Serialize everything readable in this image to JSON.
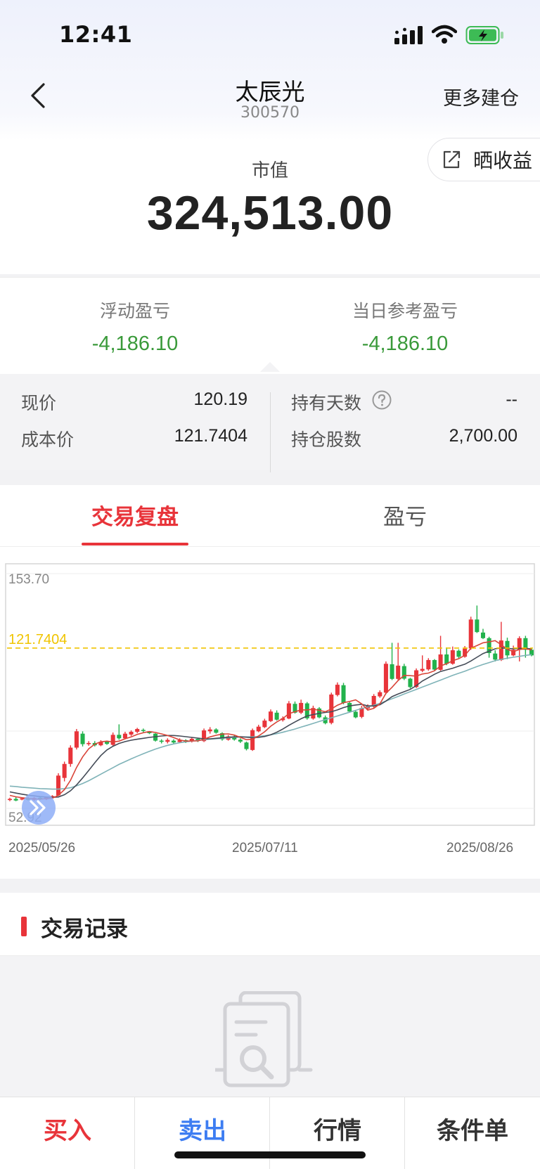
{
  "status_bar": {
    "time": "12:41"
  },
  "nav": {
    "title": "太辰光",
    "code": "300570",
    "more_label": "更多建仓"
  },
  "share": {
    "label": "晒收益"
  },
  "market_value": {
    "label": "市值",
    "value": "324,513.00"
  },
  "pl": {
    "floating_label": "浮动盈亏",
    "floating_value": "-4,186.10",
    "daily_label": "当日参考盈亏",
    "daily_value": "-4,186.10"
  },
  "details": {
    "price_label": "现价",
    "price_value": "120.19",
    "cost_label": "成本价",
    "cost_value": "121.7404",
    "days_label": "持有天数",
    "days_value": "--",
    "shares_label": "持仓股数",
    "shares_value": "2,700.00"
  },
  "tabs": {
    "review": "交易复盘",
    "pnl": "盈亏"
  },
  "chart_data": {
    "type": "candlestick",
    "y_max_label": "153.70",
    "y_min_label": "52.92",
    "ylim": [
      52.92,
      153.7
    ],
    "cost_line": 121.7404,
    "cost_label": "121.7404",
    "x_labels": [
      "2025/05/26",
      "2025/07/11",
      "2025/08/26"
    ],
    "up_color": "#e8343a",
    "down_color": "#22b24c",
    "candles": [
      [
        56.5,
        57.0,
        56.0,
        57.5
      ],
      [
        57.0,
        56.3,
        56.0,
        57.8
      ],
      [
        56.8,
        57.2,
        56.4,
        57.6
      ],
      [
        57.3,
        56.6,
        56.3,
        57.9
      ],
      [
        56.6,
        57.4,
        56.2,
        57.8
      ],
      [
        57.5,
        56.8,
        56.5,
        58.0
      ],
      [
        56.8,
        57.6,
        56.5,
        58.0
      ],
      [
        57.6,
        58.2,
        57.3,
        58.6
      ],
      [
        58.5,
        67.0,
        58.2,
        68.0
      ],
      [
        66.0,
        72.0,
        64.5,
        73.0
      ],
      [
        72.0,
        79.0,
        70.8,
        80.0
      ],
      [
        79.0,
        86.0,
        78.2,
        87.0
      ],
      [
        85.0,
        80.5,
        79.5,
        86.0
      ],
      [
        80.5,
        81.0,
        79.8,
        81.8
      ],
      [
        81.0,
        80.0,
        79.5,
        81.8
      ],
      [
        80.0,
        81.5,
        79.6,
        82.2
      ],
      [
        81.5,
        80.6,
        80.2,
        82.0
      ],
      [
        80.2,
        84.5,
        79.8,
        85.5
      ],
      [
        84.5,
        83.0,
        82.4,
        89.0
      ],
      [
        83.0,
        85.0,
        82.6,
        85.8
      ],
      [
        84.6,
        85.8,
        84.0,
        86.4
      ],
      [
        85.8,
        87.0,
        85.2,
        87.5
      ],
      [
        86.6,
        86.2,
        85.6,
        87.2
      ],
      [
        86.0,
        85.2,
        84.8,
        86.0
      ],
      [
        85.0,
        82.0,
        81.6,
        85.2
      ],
      [
        82.0,
        81.5,
        80.8,
        82.6
      ],
      [
        81.5,
        82.3,
        80.8,
        83.0
      ],
      [
        82.0,
        81.2,
        80.6,
        82.6
      ],
      [
        81.4,
        82.2,
        81.0,
        83.0
      ],
      [
        82.2,
        81.6,
        81.0,
        82.6
      ],
      [
        81.6,
        82.8,
        81.2,
        83.3
      ],
      [
        82.8,
        82.0,
        81.4,
        83.2
      ],
      [
        81.8,
        86.4,
        81.4,
        87.2
      ],
      [
        86.0,
        86.8,
        85.0,
        87.8
      ],
      [
        86.8,
        85.4,
        85.0,
        87.3
      ],
      [
        85.2,
        82.6,
        82.0,
        85.6
      ],
      [
        82.4,
        83.8,
        82.0,
        84.4
      ],
      [
        83.8,
        82.5,
        82.0,
        84.2
      ],
      [
        82.4,
        81.6,
        81.0,
        83.0
      ],
      [
        81.2,
        78.4,
        77.8,
        81.6
      ],
      [
        78.0,
        86.5,
        77.6,
        87.2
      ],
      [
        86.0,
        88.0,
        85.6,
        88.8
      ],
      [
        87.8,
        90.6,
        87.4,
        91.4
      ],
      [
        90.4,
        94.5,
        90.0,
        95.4
      ],
      [
        94.0,
        91.0,
        90.6,
        95.0
      ],
      [
        90.8,
        91.6,
        90.2,
        92.4
      ],
      [
        91.5,
        98.0,
        91.2,
        99.0
      ],
      [
        97.8,
        94.0,
        93.6,
        98.8
      ],
      [
        94.0,
        98.2,
        93.4,
        99.6
      ],
      [
        98.0,
        91.6,
        91.0,
        98.6
      ],
      [
        91.5,
        96.0,
        91.0,
        97.0
      ],
      [
        95.8,
        92.0,
        91.6,
        96.4
      ],
      [
        92.0,
        89.5,
        89.0,
        92.8
      ],
      [
        89.6,
        101.8,
        89.0,
        102.6
      ],
      [
        101.6,
        106.0,
        101.0,
        107.0
      ],
      [
        105.8,
        98.2,
        97.6,
        106.8
      ],
      [
        98.2,
        94.5,
        94.0,
        98.6
      ],
      [
        94.4,
        92.0,
        91.6,
        95.0
      ],
      [
        92.2,
        96.0,
        91.6,
        97.0
      ],
      [
        95.8,
        96.8,
        95.0,
        97.6
      ],
      [
        96.6,
        101.2,
        96.0,
        102.0
      ],
      [
        101.0,
        102.8,
        100.4,
        103.6
      ],
      [
        102.6,
        115.0,
        102.0,
        116.0
      ],
      [
        114.8,
        108.5,
        108.0,
        124.0
      ],
      [
        108.5,
        114.2,
        108.0,
        124.0
      ],
      [
        114.0,
        108.6,
        108.0,
        115.0
      ],
      [
        108.6,
        105.0,
        104.4,
        109.0
      ],
      [
        105.0,
        112.2,
        104.6,
        113.0
      ],
      [
        112.0,
        112.8,
        111.4,
        118.6
      ],
      [
        112.6,
        116.6,
        112.0,
        117.4
      ],
      [
        116.6,
        112.5,
        112.0,
        117.0
      ],
      [
        112.4,
        119.0,
        112.0,
        127.0
      ],
      [
        119.0,
        115.0,
        114.4,
        122.0
      ],
      [
        115.0,
        120.8,
        114.6,
        122.4
      ],
      [
        120.6,
        118.0,
        117.4,
        121.2
      ],
      [
        118.0,
        121.5,
        117.6,
        122.6
      ],
      [
        121.6,
        134.0,
        121.0,
        135.2
      ],
      [
        134.0,
        128.6,
        128.2,
        140.0
      ],
      [
        128.4,
        126.0,
        125.6,
        130.0
      ],
      [
        126.0,
        119.6,
        117.6,
        126.6
      ],
      [
        119.4,
        116.8,
        116.0,
        120.8
      ],
      [
        116.6,
        125.0,
        116.2,
        133.0
      ],
      [
        124.8,
        118.6,
        117.0,
        126.2
      ],
      [
        118.6,
        121.0,
        118.2,
        122.8
      ],
      [
        121.0,
        126.0,
        116.0,
        126.8
      ],
      [
        126.0,
        121.0,
        117.6,
        127.0
      ],
      [
        121.0,
        118.6,
        118.2,
        121.6
      ]
    ],
    "ma5": [
      58.5,
      57.9,
      57.5,
      57.2,
      57.0,
      56.9,
      57.1,
      57.3,
      58.5,
      61.0,
      65.0,
      70.5,
      75.0,
      78.5,
      80.5,
      81.5,
      81.8,
      81.4,
      81.8,
      82.8,
      83.6,
      84.7,
      85.4,
      85.9,
      85.5,
      84.9,
      84.2,
      83.3,
      82.3,
      81.8,
      81.9,
      81.9,
      82.6,
      83.6,
      84.3,
      84.8,
      84.9,
      84.4,
      83.4,
      82.4,
      82.6,
      84.0,
      85.8,
      88.2,
      90.0,
      91.5,
      93.6,
      94.4,
      95.2,
      95.2,
      95.5,
      95.0,
      94.4,
      95.6,
      97.2,
      98.3,
      98.8,
      99.5,
      97.8,
      95.1,
      95.9,
      97.8,
      102.3,
      104.9,
      107.8,
      110.0,
      109.9,
      109.7,
      110.6,
      111.0,
      112.0,
      114.1,
      115.0,
      116.3,
      117.2,
      118.6,
      121.7,
      122.8,
      124.0,
      124.4,
      124.9,
      123.2,
      121.2,
      120.2,
      121.1,
      121.4,
      121.0
    ],
    "ma10": [
      60.0,
      59.5,
      59.0,
      58.6,
      58.3,
      58.0,
      57.8,
      57.7,
      57.8,
      58.8,
      60.5,
      63.0,
      66.0,
      69.2,
      72.5,
      75.6,
      78.0,
      79.6,
      80.8,
      81.6,
      82.2,
      82.6,
      83.0,
      83.4,
      83.7,
      84.0,
      84.2,
      84.2,
      84.0,
      83.7,
      83.4,
      83.1,
      82.8,
      82.8,
      83.0,
      83.2,
      83.5,
      83.6,
      83.7,
      83.5,
      83.3,
      83.4,
      83.8,
      84.5,
      85.6,
      87.0,
      88.6,
      90.0,
      91.4,
      92.6,
      93.2,
      93.7,
      94.1,
      94.4,
      95.2,
      96.2,
      96.9,
      97.3,
      97.6,
      96.9,
      96.9,
      97.4,
      99.0,
      100.9,
      102.0,
      103.0,
      104.0,
      105.6,
      107.6,
      109.0,
      110.5,
      111.7,
      112.4,
      113.1,
      114.0,
      114.8,
      116.2,
      117.8,
      119.4,
      120.4,
      121.4,
      121.8,
      121.6,
      121.4,
      121.6,
      121.6,
      121.4
    ],
    "ma20": [
      62.5,
      62.3,
      62.0,
      61.8,
      61.6,
      61.4,
      61.3,
      61.2,
      61.2,
      61.4,
      61.8,
      62.6,
      63.6,
      64.8,
      66.2,
      67.6,
      69.0,
      70.4,
      71.8,
      73.0,
      74.2,
      75.3,
      76.4,
      77.4,
      78.4,
      79.2,
      80.0,
      80.6,
      81.1,
      81.5,
      81.8,
      82.1,
      82.4,
      82.6,
      82.8,
      83.0,
      83.2,
      83.4,
      83.5,
      83.6,
      83.6,
      83.8,
      84.1,
      84.5,
      85.0,
      85.6,
      86.3,
      87.0,
      87.8,
      88.6,
      89.4,
      90.2,
      91.0,
      91.8,
      92.6,
      93.4,
      94.2,
      95.0,
      95.8,
      96.4,
      97.2,
      98.0,
      99.0,
      100.0,
      101.0,
      102.0,
      103.0,
      104.0,
      105.0,
      106.0,
      107.0,
      108.0,
      109.0,
      110.0,
      110.9,
      111.8,
      112.8,
      113.8,
      114.7,
      115.5,
      116.3,
      116.9,
      117.4,
      117.8,
      118.2,
      118.6,
      118.9
    ]
  },
  "records": {
    "title": "交易记录"
  },
  "bottom_bar": {
    "buy": "买入",
    "sell": "卖出",
    "quote": "行情",
    "condition": "条件单"
  }
}
